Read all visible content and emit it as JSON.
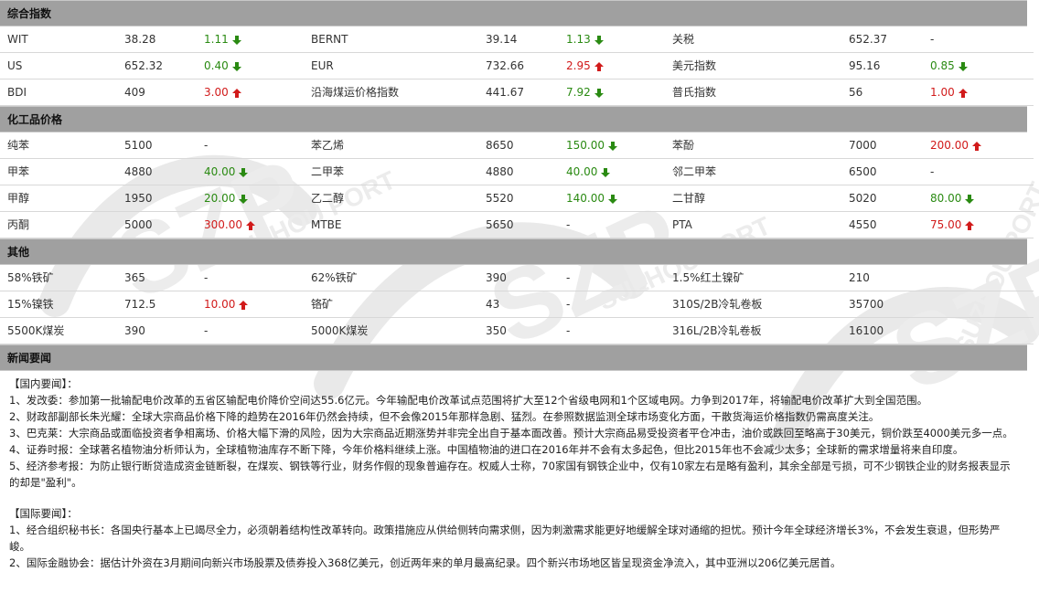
{
  "sections": {
    "index": {
      "title": "综合指数",
      "rows": [
        [
          {
            "name": "WIT",
            "value": "38.28",
            "change": "1.11",
            "dir": "down"
          },
          {
            "name": "BERNT",
            "value": "39.14",
            "change": "1.13",
            "dir": "down"
          },
          {
            "name": "关税",
            "value": "652.37",
            "change": "-",
            "dir": "none"
          }
        ],
        [
          {
            "name": "US",
            "value": "652.32",
            "change": "0.40",
            "dir": "down"
          },
          {
            "name": "EUR",
            "value": "732.66",
            "change": "2.95",
            "dir": "up"
          },
          {
            "name": "美元指数",
            "value": "95.16",
            "change": "0.85",
            "dir": "down"
          }
        ],
        [
          {
            "name": "BDI",
            "value": "409",
            "change": "3.00",
            "dir": "up"
          },
          {
            "name": "沿海煤运价格指数",
            "value": "441.67",
            "change": "7.92",
            "dir": "down"
          },
          {
            "name": "普氏指数",
            "value": "56",
            "change": "1.00",
            "dir": "up"
          }
        ]
      ]
    },
    "chemical": {
      "title": "化工品价格",
      "rows": [
        [
          {
            "name": "纯苯",
            "value": "5100",
            "change": "-",
            "dir": "none"
          },
          {
            "name": "苯乙烯",
            "value": "8650",
            "change": "150.00",
            "dir": "down"
          },
          {
            "name": "苯酚",
            "value": "7000",
            "change": "200.00",
            "dir": "up"
          }
        ],
        [
          {
            "name": "甲苯",
            "value": "4880",
            "change": "40.00",
            "dir": "down"
          },
          {
            "name": "二甲苯",
            "value": "4880",
            "change": "40.00",
            "dir": "down"
          },
          {
            "name": "邻二甲苯",
            "value": "6500",
            "change": "-",
            "dir": "none"
          }
        ],
        [
          {
            "name": "甲醇",
            "value": "1950",
            "change": "20.00",
            "dir": "down"
          },
          {
            "name": "乙二醇",
            "value": "5520",
            "change": "140.00",
            "dir": "down"
          },
          {
            "name": "二甘醇",
            "value": "5020",
            "change": "80.00",
            "dir": "down"
          }
        ],
        [
          {
            "name": "丙酮",
            "value": "5000",
            "change": "300.00",
            "dir": "up"
          },
          {
            "name": "MTBE",
            "value": "5650",
            "change": "-",
            "dir": "none"
          },
          {
            "name": "PTA",
            "value": "4550",
            "change": "75.00",
            "dir": "up"
          }
        ]
      ]
    },
    "other": {
      "title": "其他",
      "rows": [
        [
          {
            "name": "58%铁矿",
            "value": "365",
            "change": "-",
            "dir": "none"
          },
          {
            "name": "62%铁矿",
            "value": "390",
            "change": "-",
            "dir": "none"
          },
          {
            "name": "1.5%红土镍矿",
            "value": "210",
            "change": "",
            "dir": "none"
          }
        ],
        [
          {
            "name": "15%镍铁",
            "value": "712.5",
            "change": "10.00",
            "dir": "up"
          },
          {
            "name": "铬矿",
            "value": "43",
            "change": "-",
            "dir": "none"
          },
          {
            "name": "310S/2B冷轧卷板",
            "value": "35700",
            "change": "",
            "dir": "none"
          }
        ],
        [
          {
            "name": "5500K煤炭",
            "value": "390",
            "change": "-",
            "dir": "none"
          },
          {
            "name": "5000K煤炭",
            "value": "350",
            "change": "-",
            "dir": "none"
          },
          {
            "name": "316L/2B冷轧卷板",
            "value": "16100",
            "change": "",
            "dir": "none"
          }
        ]
      ]
    },
    "news": {
      "title": "新闻要闻",
      "domestic_heading": "【国内要闻】：",
      "domestic": [
        "1、发改委：参加第一批输配电价改革的五省区输配电价降价空间达55.6亿元。今年输配电价改革试点范围将扩大至12个省级电网和1个区域电网。力争到2017年，将输配电价改革扩大到全国范围。",
        "2、财政部副部长朱光耀：全球大宗商品价格下降的趋势在2016年仍然会持续，但不会像2015年那样急剧、猛烈。在参照数据监测全球市场变化方面，干散货海运价格指数仍需高度关注。",
        "3、巴克莱：大宗商品或面临投资者争相离场、价格大幅下滑的风险，因为大宗商品近期涨势并非完全出自于基本面改善。预计大宗商品易受投资者平仓冲击，油价或跌回至略高于30美元，铜价跌至4000美元多一点。",
        "4、证券时报：全球著名植物油分析师认为，全球植物油库存不断下降，今年价格料继续上涨。中国植物油的进口在2016年并不会有太多起色，但比2015年也不会减少太多；全球新的需求增量将来自印度。",
        "5、经济参考报：为防止银行断贷造成资金链断裂，在煤炭、钢铁等行业，财务作假的现象普遍存在。权威人士称，70家国有钢铁企业中，仅有10家左右是略有盈利，其余全部是亏损，可不少钢铁企业的财务报表显示的却是\"盈利\"。"
      ],
      "intl_heading": "【国际要闻】：",
      "intl": [
        "1、经合组织秘书长：各国央行基本上已竭尽全力，必须朝着结构性改革转向。政策措施应从供给侧转向需求侧，因为刺激需求能更好地缓解全球对通缩的担忧。预计今年全球经济增长3%，不会发生衰退，但形势严峻。",
        "2、国际金融协会：据估计外资在3月期间向新兴市场股票及债券投入368亿美元，创近两年来的单月最高纪录。四个新兴市场地区皆呈现资金净流入，其中亚洲以206亿美元居首。"
      ]
    }
  },
  "colors": {
    "header_bg": "#a0a0a0",
    "down": "#2a8a12",
    "up": "#d11a1a"
  },
  "watermark_text": "SUZHOU PORT"
}
